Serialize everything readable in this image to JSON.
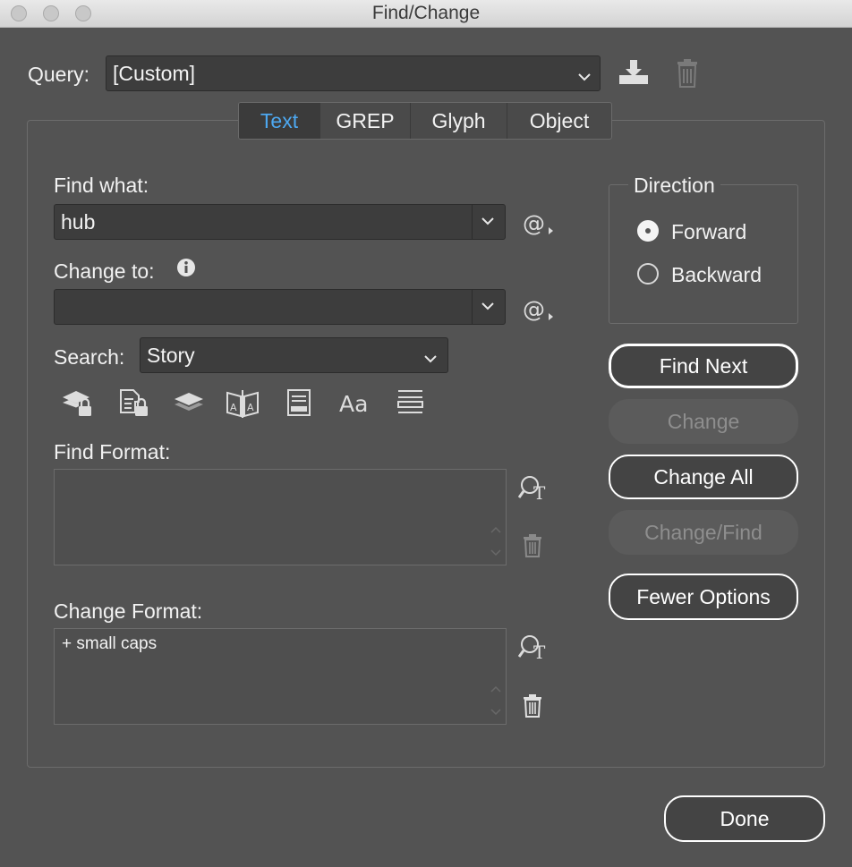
{
  "window": {
    "title": "Find/Change"
  },
  "query": {
    "label": "Query:",
    "value": "[Custom]"
  },
  "tabs": [
    {
      "label": "Text",
      "active": true
    },
    {
      "label": "GREP",
      "active": false
    },
    {
      "label": "Glyph",
      "active": false
    },
    {
      "label": "Object",
      "active": false
    }
  ],
  "find_what": {
    "label": "Find what:",
    "value": "hub"
  },
  "change_to": {
    "label": "Change to:",
    "value": ""
  },
  "search": {
    "label": "Search:",
    "value": "Story"
  },
  "find_format": {
    "label": "Find Format:",
    "value": ""
  },
  "change_format": {
    "label": "Change Format:",
    "value": "+ small caps"
  },
  "direction": {
    "label": "Direction",
    "options": [
      {
        "label": "Forward",
        "selected": true
      },
      {
        "label": "Backward",
        "selected": false
      }
    ]
  },
  "buttons": {
    "find_next": "Find Next",
    "change": "Change",
    "change_all": "Change All",
    "change_find": "Change/Find",
    "fewer_options": "Fewer Options",
    "done": "Done"
  },
  "search_options_icons": [
    "include-locked-layers-icon",
    "include-locked-stories-icon",
    "include-hidden-layers-icon",
    "include-master-pages-icon",
    "include-footnotes-icon",
    "case-sensitive-icon",
    "whole-word-icon"
  ],
  "colors": {
    "accent": "#4da8f0",
    "background": "#535353"
  }
}
